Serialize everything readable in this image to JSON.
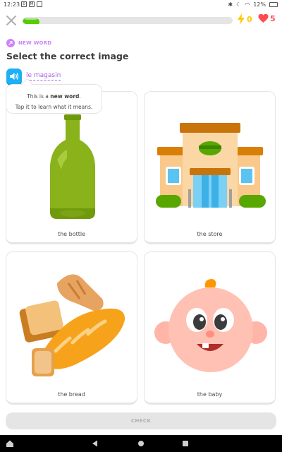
{
  "status_bar": {
    "time": "12:23",
    "battery": "12%"
  },
  "header": {
    "progress_fraction": 0.08,
    "energy_count": "0",
    "hearts_count": "5",
    "colors": {
      "progress": "#58cc02",
      "energy": "#ffc800",
      "hearts": "#ff4b4b"
    }
  },
  "lesson": {
    "tag_label": "NEW WORD",
    "title": "Select the correct image",
    "word": "le magasin",
    "tooltip": {
      "line1_prefix": "This is a ",
      "line1_bold": "new word",
      "line1_suffix": ".",
      "line2": "Tap it to learn what it means."
    }
  },
  "options": [
    {
      "label": "the bottle",
      "icon": "bottle-illustration"
    },
    {
      "label": "the store",
      "icon": "store-illustration"
    },
    {
      "label": "the bread",
      "icon": "bread-illustration"
    },
    {
      "label": "the baby",
      "icon": "baby-illustration"
    }
  ],
  "footer": {
    "check_label": "CHECK"
  },
  "colors": {
    "accent_purple": "#ce82ff",
    "speaker_blue": "#1cb0f6"
  }
}
